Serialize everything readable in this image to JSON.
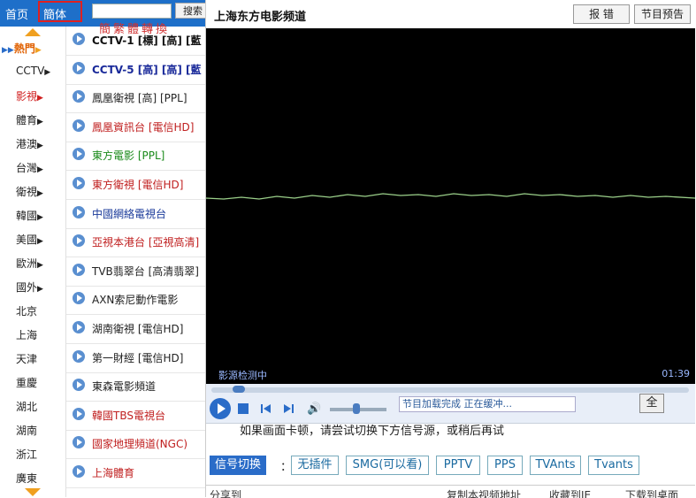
{
  "topbar": {
    "home": "首页",
    "simplified": "簡体",
    "search_label": "搜索",
    "convert": "簡繁體轉換"
  },
  "categories": [
    {
      "label": "熱門"
    },
    {
      "label": "CCTV"
    },
    {
      "label": "影視"
    },
    {
      "label": "體育"
    },
    {
      "label": "港澳"
    },
    {
      "label": "台灣"
    },
    {
      "label": "衛視"
    },
    {
      "label": "韓國"
    },
    {
      "label": "美國"
    },
    {
      "label": "歐洲"
    },
    {
      "label": "國外"
    },
    {
      "label": "北京"
    },
    {
      "label": "上海"
    },
    {
      "label": "天津"
    },
    {
      "label": "重慶"
    },
    {
      "label": "湖北"
    },
    {
      "label": "湖南"
    },
    {
      "label": "浙江"
    },
    {
      "label": "廣東"
    }
  ],
  "channels": [
    {
      "label": "CCTV-1 [標] [高] [藍",
      "color": "#111111"
    },
    {
      "label": "CCTV-5 [高] [高] [藍",
      "color": "#1a2a9a"
    },
    {
      "label": "鳳凰衛視 [高] [PPL]",
      "color": "#222222"
    },
    {
      "label": "鳳凰資訊台 [電信HD]",
      "color": "#c02020"
    },
    {
      "label": "東方電影 [PPL]",
      "color": "#1a8a1a"
    },
    {
      "label": "東方衛視 [電信HD]",
      "color": "#c02020"
    },
    {
      "label": "中國網絡電視台",
      "color": "#1a3a9a"
    },
    {
      "label": "亞視本港台 [亞視高清]",
      "color": "#c02020"
    },
    {
      "label": "TVB翡翠台 [高清翡翠]",
      "color": "#222222"
    },
    {
      "label": "AXN索尼動作電影",
      "color": "#222222"
    },
    {
      "label": "湖南衛視 [電信HD]",
      "color": "#222222"
    },
    {
      "label": "第一財經 [電信HD]",
      "color": "#222222"
    },
    {
      "label": "東森電影頻道",
      "color": "#222222"
    },
    {
      "label": "韓國TBS電視台",
      "color": "#c02020"
    },
    {
      "label": "國家地理頻道(NGC)",
      "color": "#c02020"
    },
    {
      "label": "上海體育",
      "color": "#c02020"
    }
  ],
  "player": {
    "title": "上海东方电影频道",
    "report": "报 错",
    "schedule": "节目预告",
    "status": "影源检测中",
    "time": "01:39",
    "control_text": "节目加载完成 正在缓冲...",
    "fullscreen": "全"
  },
  "notice": "如果画面卡顿，请尝试切换下方信号源，或稍后再试",
  "sources": {
    "label": "信号切换",
    "sep": "：",
    "items": [
      "无插件",
      "SMG(可以看)",
      "PPTV",
      "PPS",
      "TVAnts",
      "Tvants"
    ]
  },
  "bottom": {
    "share": "分享到",
    "favorite": "复制本视频地址",
    "collect": "收藏到IE",
    "download": "下载到桌面"
  }
}
